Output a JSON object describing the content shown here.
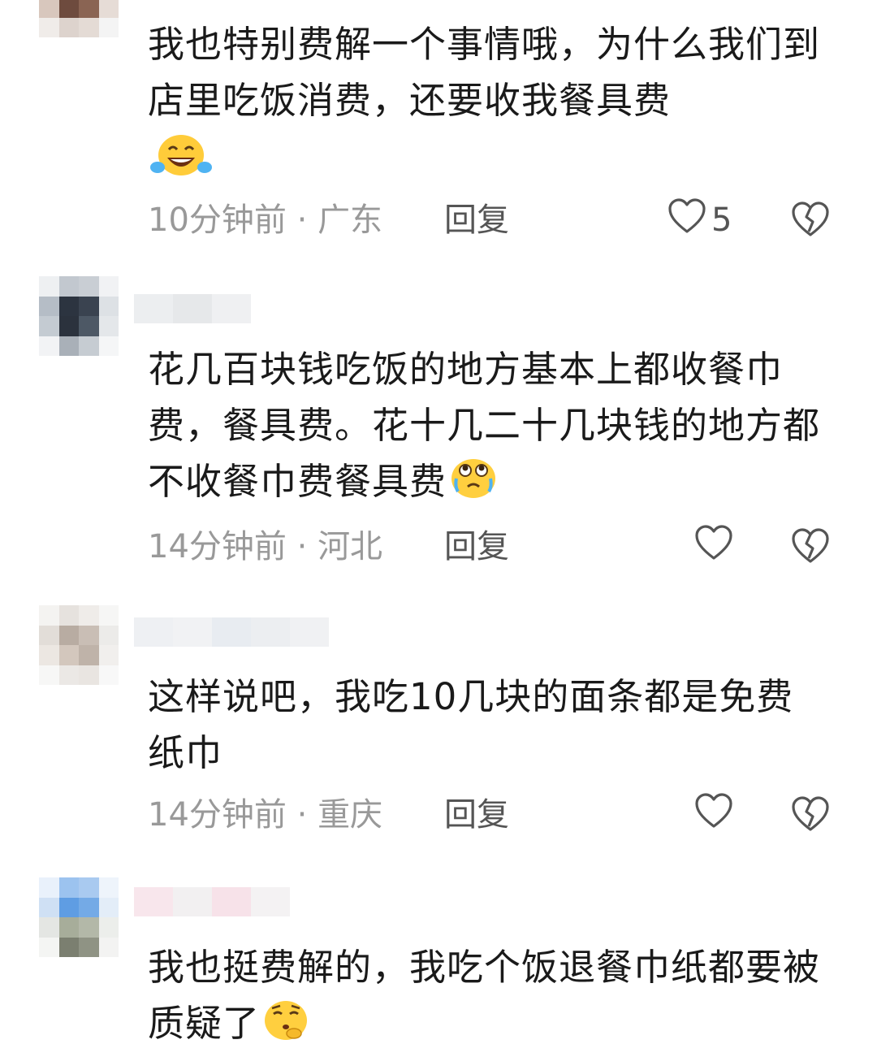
{
  "comments": [
    {
      "text": "我也特别费解一个事情哦，为什么我们到店里吃饭消费，还要收我餐具费",
      "emoji": "laughing-tears-emoji",
      "time": "10分钟前",
      "separator": " · ",
      "location": "广东",
      "reply_label": "回复",
      "like_count": "5"
    },
    {
      "text": "花几百块钱吃饭的地方基本上都收餐巾费，餐具费。花十几二十几块钱的地方都不收餐巾费餐具费",
      "emoji": "crying-looking-up-emoji",
      "time": "14分钟前",
      "separator": " · ",
      "location": "河北",
      "reply_label": "回复",
      "like_count": ""
    },
    {
      "text": "这样说吧，我吃10几块的面条都是免费纸巾",
      "time": "14分钟前",
      "separator": " · ",
      "location": "重庆",
      "reply_label": "回复",
      "like_count": ""
    },
    {
      "text": "我也挺费解的，我吃个饭退餐巾纸都要被质疑了",
      "emoji": "thinking-sigh-emoji"
    }
  ],
  "icons": {
    "like": "heart-outline-icon",
    "dislike": "broken-heart-icon"
  },
  "colors": {
    "text": "#1a1a1a",
    "meta": "#999999",
    "action": "#555555"
  }
}
